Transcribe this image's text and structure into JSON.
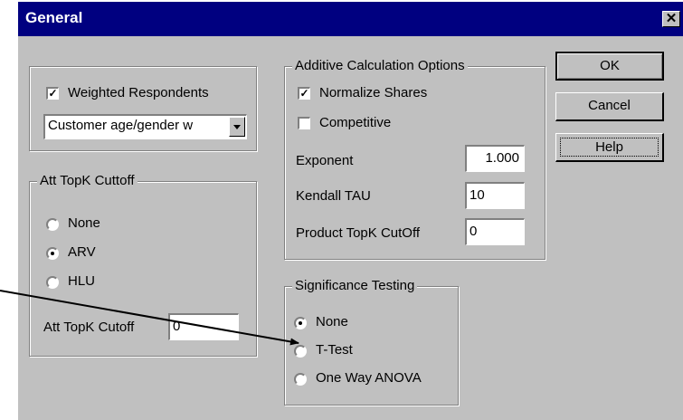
{
  "window": {
    "title": "General",
    "close_glyph": "✕"
  },
  "weighting": {
    "checkbox_label": "Weighted Respondents",
    "checked": true,
    "combo_value": "Customer age/gender w"
  },
  "att_topk": {
    "legend": "Att TopK Cuttoff",
    "options": [
      {
        "label": "None",
        "selected": false
      },
      {
        "label": "ARV",
        "selected": true
      },
      {
        "label": "HLU",
        "selected": false
      }
    ],
    "cutoff_label": "Att TopK Cutoff",
    "cutoff_value": "0"
  },
  "additive": {
    "legend": "Additive Calculation Options",
    "normalize_label": "Normalize Shares",
    "normalize_checked": true,
    "competitive_label": "Competitive",
    "competitive_checked": false,
    "exponent_label": "Exponent",
    "exponent_value": "1.000",
    "kendall_label": "Kendall TAU",
    "kendall_value": "10",
    "product_topk_label": "Product TopK CutOff",
    "product_topk_value": "0"
  },
  "significance": {
    "legend": "Significance Testing",
    "options": [
      {
        "label": "None",
        "selected": true
      },
      {
        "label": "T-Test",
        "selected": false
      },
      {
        "label": "One Way ANOVA",
        "selected": false
      }
    ]
  },
  "buttons": {
    "ok": "OK",
    "cancel": "Cancel",
    "help": "Help"
  },
  "annotation": {
    "color": "#000000",
    "points_to": "T-Test radio"
  }
}
